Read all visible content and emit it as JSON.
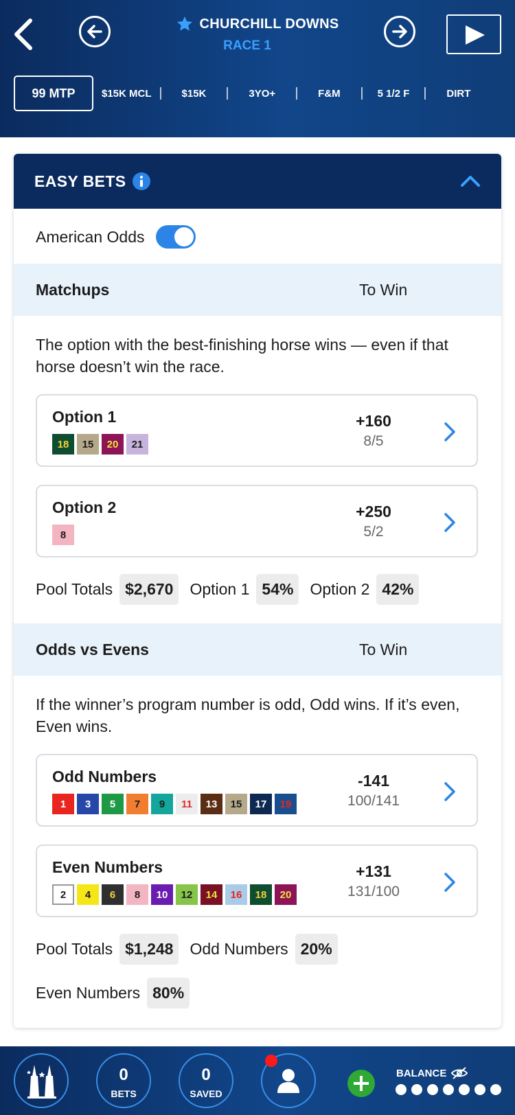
{
  "header": {
    "track_name": "CHURCHILL DOWNS",
    "race_label": "RACE 1",
    "mtp": "99 MTP",
    "race_info": [
      "$15K MCL",
      "$15K",
      "3YO+",
      "F&M",
      "5 1/2 F",
      "DIRT"
    ]
  },
  "easy_bets": {
    "title": "EASY BETS",
    "odds_toggle_label": "American Odds",
    "odds_toggle_on": true
  },
  "matchups": {
    "name": "Matchups",
    "to_win_label": "To Win",
    "description": "The option with the best-finishing horse wins — even if that horse doesn’t win the race.",
    "options": [
      {
        "name": "Option 1",
        "american": "+160",
        "fraction": "8/5",
        "numbers": [
          {
            "n": "18",
            "bg": "#0e4d2f",
            "fg": "#f3d03e"
          },
          {
            "n": "15",
            "bg": "#b6a88a",
            "fg": "#1c1c1c"
          },
          {
            "n": "20",
            "bg": "#8c1457",
            "fg": "#f3e23c"
          },
          {
            "n": "21",
            "bg": "#c7b4dd",
            "fg": "#1c1c1c"
          }
        ]
      },
      {
        "name": "Option 2",
        "american": "+250",
        "fraction": "5/2",
        "numbers": [
          {
            "n": "8",
            "bg": "#f4b5c2",
            "fg": "#1c1c1c"
          }
        ]
      }
    ],
    "pool": {
      "label": "Pool Totals",
      "total": "$2,670",
      "opt1_label": "Option 1",
      "opt1_pct": "54%",
      "opt2_label": "Option 2",
      "opt2_pct": "42%"
    }
  },
  "odds_evens": {
    "name": "Odds vs Evens",
    "to_win_label": "To Win",
    "description": "If the winner’s program number is odd, Odd wins. If it’s even, Even wins.",
    "options": [
      {
        "name": "Odd Numbers",
        "american": "-141",
        "fraction": "100/141",
        "numbers": [
          {
            "n": "1",
            "bg": "#e8261f",
            "fg": "#ffffff"
          },
          {
            "n": "3",
            "bg": "#2747a8",
            "fg": "#ffffff"
          },
          {
            "n": "5",
            "bg": "#1e9a46",
            "fg": "#ffffff"
          },
          {
            "n": "7",
            "bg": "#f07d30",
            "fg": "#1c1c1c"
          },
          {
            "n": "9",
            "bg": "#14a69a",
            "fg": "#1c1c1c"
          },
          {
            "n": "11",
            "bg": "#ececec",
            "fg": "#e02b2b"
          },
          {
            "n": "13",
            "bg": "#5a2d14",
            "fg": "#ffffff"
          },
          {
            "n": "15",
            "bg": "#b6a88a",
            "fg": "#1c1c1c"
          },
          {
            "n": "17",
            "bg": "#0d2952",
            "fg": "#ffffff"
          },
          {
            "n": "19",
            "bg": "#1a4f8f",
            "fg": "#e8261f"
          }
        ]
      },
      {
        "name": "Even Numbers",
        "american": "+131",
        "fraction": "131/100",
        "numbers": [
          {
            "n": "2",
            "bg": "#ffffff",
            "fg": "#1c1c1c",
            "border": true
          },
          {
            "n": "4",
            "bg": "#f5e617",
            "fg": "#1c1c1c"
          },
          {
            "n": "6",
            "bg": "#2f2f2f",
            "fg": "#f3d03e"
          },
          {
            "n": "8",
            "bg": "#f4b5c2",
            "fg": "#1c1c1c"
          },
          {
            "n": "10",
            "bg": "#6a1bb0",
            "fg": "#ffffff"
          },
          {
            "n": "12",
            "bg": "#86c54a",
            "fg": "#1c1c1c"
          },
          {
            "n": "14",
            "bg": "#7a1024",
            "fg": "#f3e23c"
          },
          {
            "n": "16",
            "bg": "#a9cbe8",
            "fg": "#e8261f"
          },
          {
            "n": "18",
            "bg": "#0e4d2f",
            "fg": "#f3d03e"
          },
          {
            "n": "20",
            "bg": "#8c1457",
            "fg": "#f3e23c"
          }
        ]
      }
    ],
    "pool": {
      "label": "Pool Totals",
      "total": "$1,248",
      "odd_label": "Odd Numbers",
      "odd_pct": "20%",
      "even_label": "Even Numbers",
      "even_pct": "80%"
    }
  },
  "bottom_nav": {
    "bets_count": "0",
    "bets_label": "BETS",
    "saved_count": "0",
    "saved_label": "SAVED",
    "balance_label": "BALANCE"
  },
  "colors": {
    "brand_navy": "#0b2b5e",
    "accent_blue": "#2b84e6",
    "section_bg": "#e8f2fb",
    "add_green": "#2fa836",
    "notif_red": "#ff1a1a"
  }
}
